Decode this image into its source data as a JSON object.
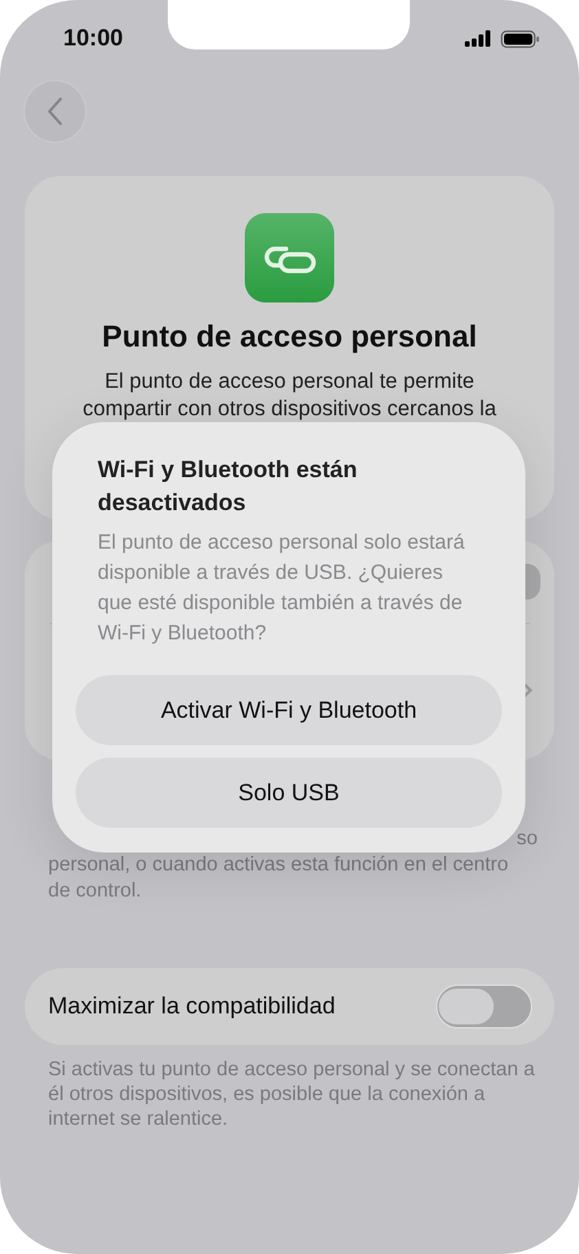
{
  "status_bar": {
    "time": "10:00"
  },
  "header": {
    "title": "Punto de acceso personal",
    "description_lines": [
      "El punto de acceso personal te permite",
      "compartir con otros dispositivos cercanos la"
    ]
  },
  "settings_rows": [
    {
      "kind": "toggle",
      "on": false
    },
    {
      "kind": "link"
    }
  ],
  "settings_footer": {
    "lines": [
      {
        "right": "so"
      },
      {
        "left": "personal, o cuando activas esta función en el centro"
      },
      {
        "left": "de control."
      }
    ]
  },
  "compatibility": {
    "label": "Maximizar la compatibilidad",
    "on": false,
    "footer": "Si activas tu punto de acceso personal y se conectan a él otros dispositivos, es posible que la conexión a internet se ralentice."
  },
  "alert": {
    "title": "Wi-Fi y Bluetooth están desactivados",
    "message": "El punto de acceso personal solo estará disponible a través de USB. ¿Quieres que esté disponible también a través de Wi-Fi y Bluetooth?",
    "buttons": [
      "Activar Wi-Fi y Bluetooth",
      "Solo USB"
    ]
  }
}
